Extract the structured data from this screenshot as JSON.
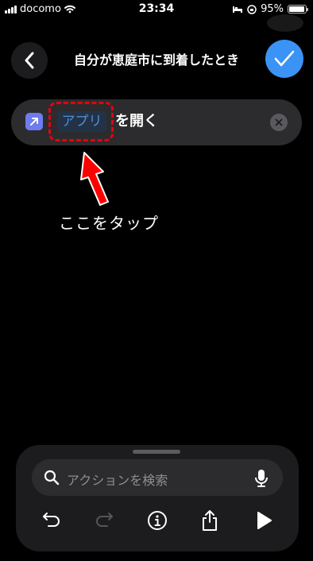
{
  "status_bar": {
    "carrier": "docomo",
    "time": "23:34",
    "battery": "95%",
    "battery_level": 0.95
  },
  "header": {
    "title": "自分が恵庭市に到着したとき"
  },
  "action": {
    "token": "アプリ",
    "text": "を開く"
  },
  "annotation": {
    "text": "ここをタップ"
  },
  "bottom": {
    "search_placeholder": "アクションを検索"
  },
  "colors": {
    "accent": "#3b93f5",
    "highlight": "#e60012",
    "token_text": "#4f8ed6"
  },
  "icons": [
    "chevron-left-icon",
    "checkmark-icon",
    "arrow-up-right-icon",
    "clear-icon",
    "search-icon",
    "mic-icon",
    "undo-icon",
    "redo-icon",
    "info-icon",
    "share-icon",
    "play-icon"
  ]
}
